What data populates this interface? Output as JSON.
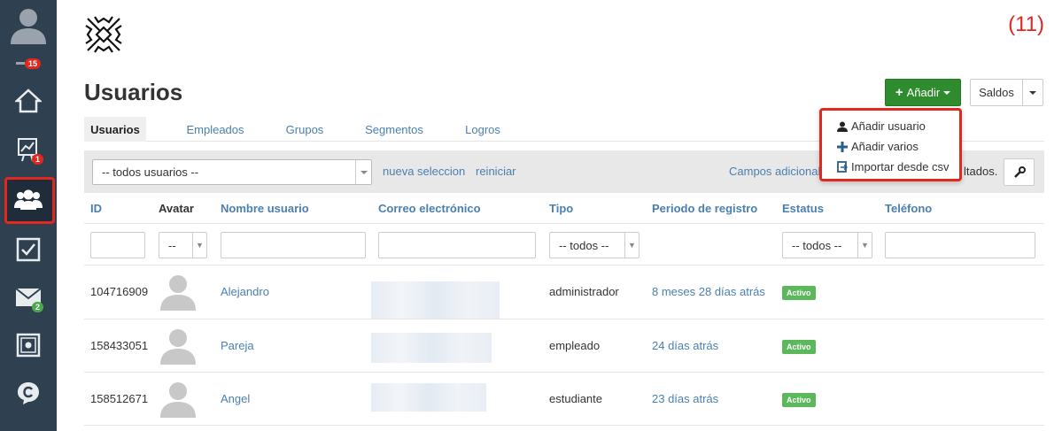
{
  "sidebar": {
    "badges": {
      "notifications": "15",
      "reports": "1",
      "messages": "2"
    },
    "items": [
      "home",
      "reports",
      "users",
      "tasks",
      "messages",
      "vault",
      "chat"
    ]
  },
  "header": {
    "counter": "(11)",
    "title": "Usuarios"
  },
  "actions": {
    "add_label": "Añadir",
    "saldos_label": "Saldos",
    "dropdown": [
      {
        "label": "Añadir usuario",
        "icon": "user-icon"
      },
      {
        "label": "Añadir varios",
        "icon": "plus-icon"
      },
      {
        "label": "Importar desde csv",
        "icon": "import-icon"
      }
    ]
  },
  "tabs": [
    "Usuarios",
    "Empleados",
    "Grupos",
    "Segmentos",
    "Logros"
  ],
  "filterbar": {
    "select_value": "-- todos usuarios --",
    "new_selection": "nueva seleccion",
    "reset": "reiniciar",
    "extra_fields": "Campos adicionale",
    "results": "ltados."
  },
  "table": {
    "headers": [
      "ID",
      "Avatar",
      "Nombre usuario",
      "Correo electrónico",
      "Tipo",
      "Periodo de registro",
      "Estatus",
      "Teléfono"
    ],
    "filters": {
      "avatar": "--",
      "tipo": "-- todos --",
      "estatus": "-- todos --"
    },
    "rows": [
      {
        "id": "104716909",
        "name": "Alejandro",
        "type": "administrador",
        "period": "8 meses 28 días atrás",
        "status": "Activo"
      },
      {
        "id": "158433051",
        "name": "Pareja",
        "type": "empleado",
        "period": "24 días atrás",
        "status": "Activo"
      },
      {
        "id": "158512671",
        "name": "Angel",
        "type": "estudiante",
        "period": "23 días atrás",
        "status": "Activo"
      }
    ]
  },
  "colors": {
    "sidebar": "#2f4050",
    "accent_red": "#e0281f",
    "add_green": "#2e8b2e",
    "link": "#4a7fb0",
    "status_green": "#5cb85c"
  }
}
